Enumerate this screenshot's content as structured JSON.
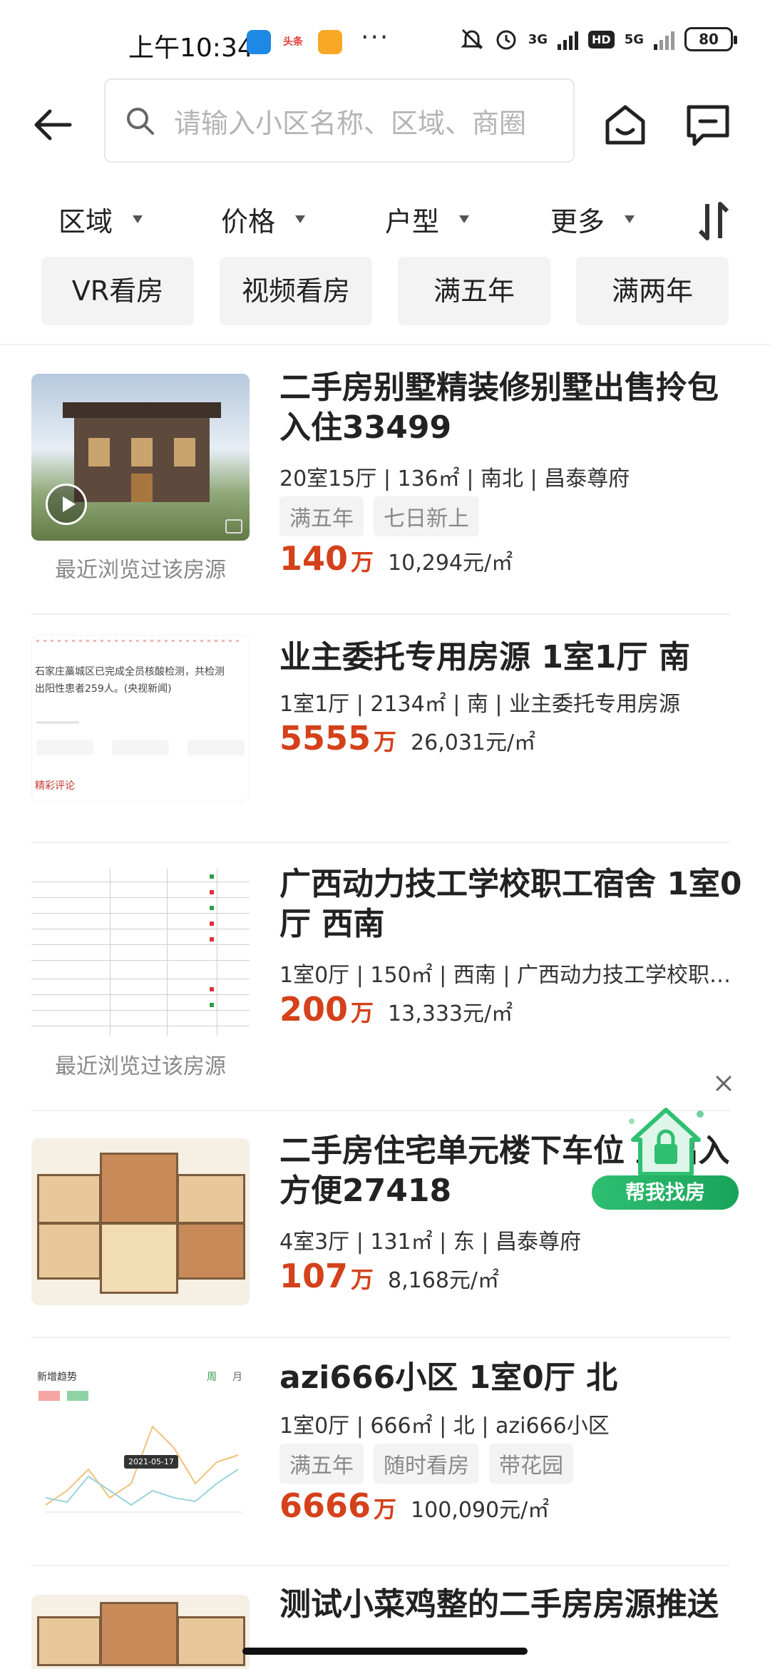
{
  "status_bar": {
    "time": "上午10:34",
    "app_badge_2": "头条",
    "more": "···",
    "net1": "3G",
    "hd": "HD",
    "net2": "5G",
    "battery": "80"
  },
  "search": {
    "placeholder": "请输入小区名称、区域、商圈"
  },
  "filters": [
    "区域",
    "价格",
    "户型",
    "更多"
  ],
  "quick_tags": [
    "VR看房",
    "视频看房",
    "满五年",
    "满两年"
  ],
  "listings": [
    {
      "title": "二手房别墅精装修别墅出售拎包入住33499",
      "meta": "20室15厅 | 136㎡ | 南北 | 昌泰尊府",
      "tags": [
        "满五年",
        "七日新上"
      ],
      "price": "140",
      "price_unit": "万",
      "unit_price": "10,294元/㎡",
      "recent_note": "最近浏览过该房源"
    },
    {
      "title": "业主委托专用房源 1室1厅 南",
      "meta": "1室1厅 | 2134㎡ | 南 | 业主委托专用房源",
      "tags": [],
      "price": "5555",
      "price_unit": "万",
      "unit_price": "26,031元/㎡",
      "recent_note": "",
      "thumb_text_1": "石家庄藁城区已完成全员核酸检测，共检测",
      "thumb_text_2": "出阳性患者259人。(央视新闻)",
      "thumb_text_3": "精彩评论"
    },
    {
      "title": "广西动力技工学校职工宿舍 1室0厅 西南",
      "meta": "1室0厅 | 150㎡ | 西南 | 广西动力技工学校职…",
      "tags": [],
      "price": "200",
      "price_unit": "万",
      "unit_price": "13,333元/㎡",
      "recent_note": "最近浏览过该房源"
    },
    {
      "title": "二手房住宅单元楼下车位 上出入方便27418",
      "meta": "4室3厅 | 131㎡ | 东 | 昌泰尊府",
      "tags": [],
      "price": "107",
      "price_unit": "万",
      "unit_price": "8,168元/㎡",
      "recent_note": ""
    },
    {
      "title": "azi666小区 1室0厅 北",
      "meta": "1室0厅 | 666㎡ | 北 | azi666小区",
      "tags": [
        "满五年",
        "随时看房",
        "带花园"
      ],
      "price": "6666",
      "price_unit": "万",
      "unit_price": "100,090元/㎡",
      "recent_note": "",
      "thumb_text_1": "新增趋势",
      "thumb_text_2": "周",
      "thumb_text_3": "月",
      "thumb_text_4": "2021-05-17"
    },
    {
      "title": "测试小菜鸡整的二手房房源推送",
      "meta": "",
      "tags": [],
      "price": "",
      "price_unit": "",
      "unit_price": "",
      "recent_note": ""
    }
  ],
  "float_widget": {
    "label": "帮我找房",
    "close": "×"
  },
  "colors": {
    "price": "#d4411a",
    "badge_green": "#2fbf71",
    "placeholder": "#b4b4b4"
  }
}
